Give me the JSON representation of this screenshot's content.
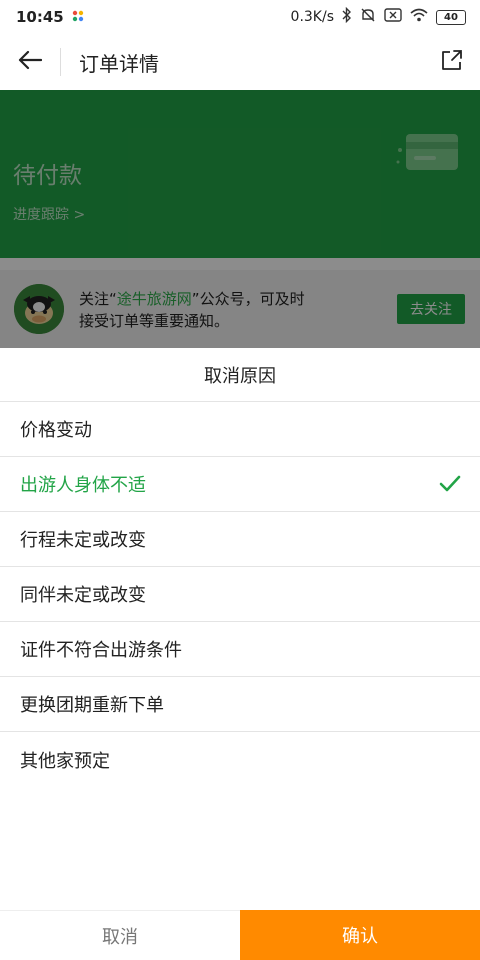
{
  "status_bar": {
    "time": "10:45",
    "network_speed": "0.3K/s",
    "battery": "40",
    "icons": [
      "bluetooth-icon",
      "mute-icon",
      "sim-icon",
      "wifi-icon",
      "battery-icon"
    ]
  },
  "header": {
    "title": "订单详情",
    "back_icon": "arrow-left-icon",
    "share_icon": "share-icon"
  },
  "banner": {
    "status": "待付款",
    "progress_link": "进度跟踪 >"
  },
  "follow": {
    "text_prefix": "关注“",
    "brand": "途牛旅游网",
    "text_suffix": "”公众号，可及时接受订单等重要通知。",
    "button": "去关注"
  },
  "sheet": {
    "title": "取消原因",
    "reasons": [
      "价格变动",
      "出游人身体不适",
      "行程未定或改变",
      "同伴未定或改变",
      "证件不符合出游条件",
      "更换团期重新下单",
      "其他家预定"
    ],
    "selected_index": 1
  },
  "actions": {
    "cancel": "取消",
    "confirm": "确认"
  },
  "colors": {
    "brand_green": "#22a447",
    "confirm_orange": "#ff8a00"
  }
}
